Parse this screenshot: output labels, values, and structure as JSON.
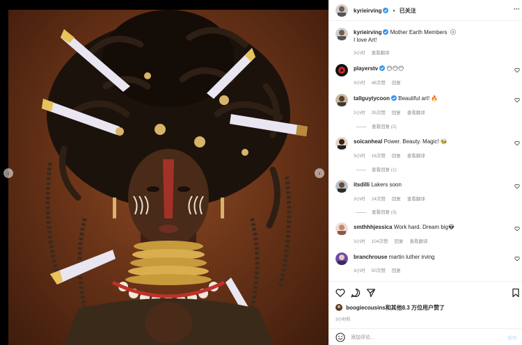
{
  "header": {
    "username": "kyrieirving",
    "separator": "•",
    "follow_label": "已关注"
  },
  "caption": {
    "username": "kyrieirving",
    "tag": "Mother Earth Members",
    "text": "I love Art!",
    "time": "3小时",
    "translate": "查看翻译"
  },
  "comments": [
    {
      "username": "playerstv",
      "text": "😶😶😶",
      "time": "3小时",
      "likes": "48次赞",
      "reply": "回复",
      "verified": true
    },
    {
      "username": "tallguytycoon",
      "text": "Beautiful art! 🔥",
      "time": "2小时",
      "likes": "35次赞",
      "reply": "回复",
      "translate": "查看翻译",
      "verified": true,
      "view_replies": "查看回复 (2)"
    },
    {
      "username": "soicanheal",
      "text": "Power. Beauty. Magic! 🐝",
      "time": "3小时",
      "likes": "16次赞",
      "reply": "回复",
      "translate": "查看翻译",
      "view_replies": "查看回复 (1)"
    },
    {
      "username": "itsdilli",
      "text": "Lakers soon",
      "time": "3小时",
      "likes": "24次赞",
      "reply": "回复",
      "translate": "查看翻译",
      "view_replies": "查看回复 (3)"
    },
    {
      "username": "smthhhjessica",
      "text": "Work hard. Dream big👽",
      "time": "3小时",
      "likes": "104次赞",
      "reply": "回复",
      "translate": "查看翻译"
    },
    {
      "username": "branchrouse",
      "text": "martin luther irving",
      "time": "3小时",
      "likes": "50次赞",
      "reply": "回复"
    }
  ],
  "likes": {
    "username": "boogiecousins",
    "rest": "和其他8.3 万位用户赞了"
  },
  "post_time": "3小时前",
  "comment_box": {
    "placeholder": "添加评论...",
    "post_label": "发布"
  },
  "icons": {
    "prev": "chevron-left-icon",
    "next": "chevron-right-icon",
    "like": "heart-icon",
    "comment": "comment-icon",
    "share": "share-icon",
    "save": "bookmark-icon",
    "emoji": "emoji-icon",
    "verified": "verified-badge-icon"
  },
  "colors": {
    "verified": "#3897f0",
    "muted": "#8e8e8e",
    "post_button": "#b2dffc"
  }
}
